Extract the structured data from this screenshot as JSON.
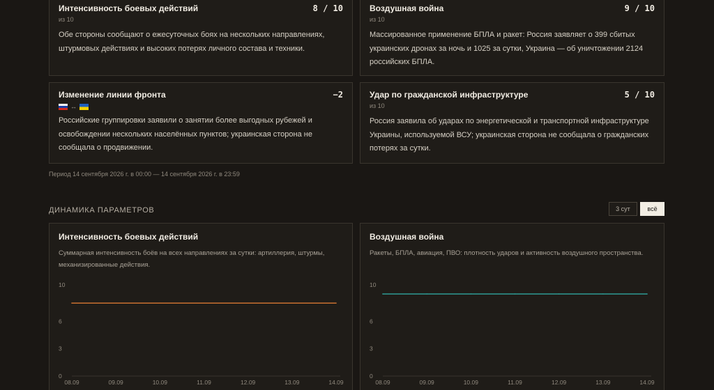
{
  "cards": [
    {
      "title": "Интенсивность боевых действий",
      "score": "8 / 10",
      "sub": "из 10",
      "text": "Обе стороны сообщают о ежесуточных боях на нескольких направлениях, штурмовых действиях и высоких потерях личного состава и техники."
    },
    {
      "title": "Воздушная война",
      "score": "9 / 10",
      "sub": "из 10",
      "text": "Массированное применение БПЛА и ракет: Россия заявляет о 399 сбитых украинских дронах за ночь и 1025 за сутки, Украина — об уничтожении 2124 российских БПЛА."
    },
    {
      "title": "Изменение линии фронта",
      "score": "−2",
      "flags_arrow": "↔",
      "text": "Российские группировки заявили о занятии более выгодных рубежей и освобождении нескольких населённых пунктов; украинская сторона не сообщала о продвижении."
    },
    {
      "title": "Удар по гражданской инфраструктуре",
      "score": "5 / 10",
      "sub": "из 10",
      "text": "Россия заявила об ударах по энергетической и транспортной инфраструктуре Украины, используемой ВСУ; украинская сторона не сообщала о гражданских потерях за сутки."
    }
  ],
  "period": "Период 14 сентября 2026 г. в 00:00 — 14 сентября 2026 г. в 23:59",
  "dynamics": {
    "section_title": "ДИНАМИКА ПАРАМЕТРОВ",
    "toggle_3d": "3 сут",
    "toggle_all": "всё",
    "active_toggle": "всё"
  },
  "chart_data": [
    {
      "type": "line",
      "title": "Интенсивность боевых действий",
      "description": "Суммарная интенсивность боёв на всех направлениях за сутки: артиллерия, штурмы, механизированные действия.",
      "categories": [
        "08.09",
        "09.09",
        "10.09",
        "11.09",
        "12.09",
        "13.09",
        "14.09"
      ],
      "series": [
        {
          "values": [
            8,
            8,
            8,
            8,
            8,
            8,
            8
          ],
          "color": "#c8702f"
        }
      ],
      "ylim": [
        0,
        10
      ],
      "yticks": [
        0,
        3,
        6,
        10
      ],
      "grid": false
    },
    {
      "type": "line",
      "title": "Воздушная война",
      "description": "Ракеты, БПЛА, авиация, ПВО: плотность ударов и активность воздушного пространства.",
      "categories": [
        "08.09",
        "09.09",
        "10.09",
        "11.09",
        "12.09",
        "13.09",
        "14.09"
      ],
      "series": [
        {
          "values": [
            9,
            9,
            9,
            9,
            9,
            9,
            9
          ],
          "color": "#2e9a93"
        }
      ],
      "ylim": [
        0,
        10
      ],
      "yticks": [
        0,
        3,
        6,
        10
      ],
      "grid": false
    }
  ]
}
